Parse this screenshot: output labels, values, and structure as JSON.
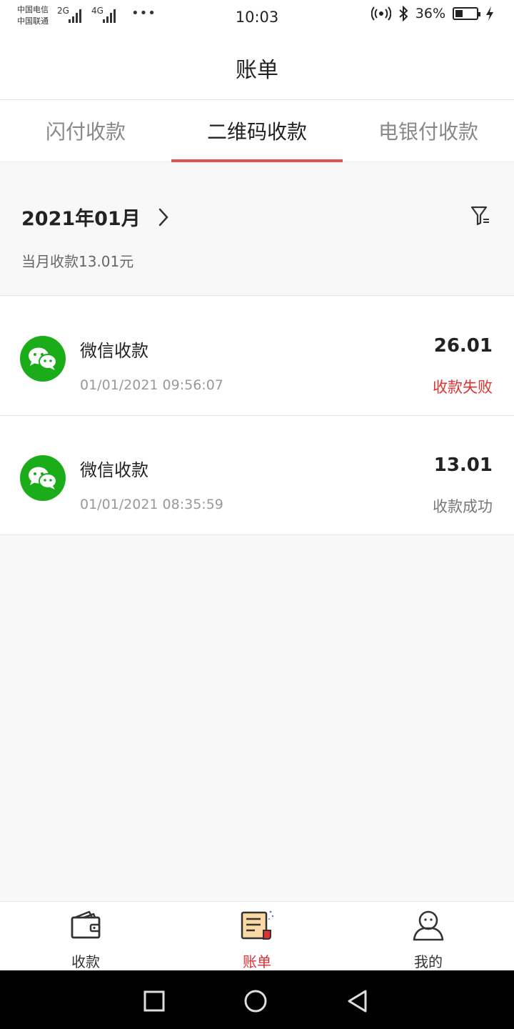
{
  "status_bar": {
    "carrier_top": "中国电信",
    "carrier_bottom": "中国联通",
    "signal1": "2G",
    "signal2": "4G",
    "more": "•••",
    "time": "10:03",
    "battery": "36%",
    "battery_level": 0.36
  },
  "header": {
    "title": "账单"
  },
  "tabs": [
    {
      "label": "闪付收款"
    },
    {
      "label": "二维码收款"
    },
    {
      "label": "电银付收款"
    }
  ],
  "active_tab": 1,
  "month": {
    "label": "2021年01月",
    "total": "当月收款13.01元"
  },
  "transactions": [
    {
      "title": "微信收款",
      "time": "01/01/2021 09:56:07",
      "amount": "26.01",
      "status": "收款失败",
      "status_color": "#e0302f"
    },
    {
      "title": "微信收款",
      "time": "01/01/2021 08:35:59",
      "amount": "13.01",
      "status": "收款成功",
      "status_color": "#777777"
    }
  ],
  "bottom_nav": [
    {
      "label": "收款",
      "icon": "wallet-icon"
    },
    {
      "label": "账单",
      "icon": "bill-icon"
    },
    {
      "label": "我的",
      "icon": "profile-icon"
    }
  ],
  "colors": {
    "accent": "#e25050",
    "wechat_green": "#1aad19"
  }
}
